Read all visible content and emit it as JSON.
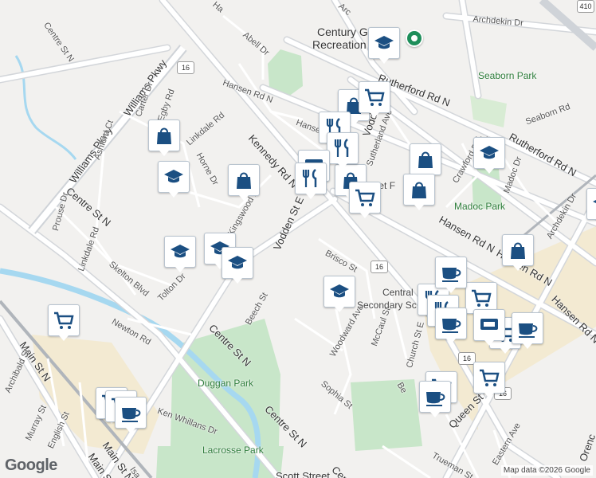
{
  "map": {
    "attribution": "Map data ©2026 Google",
    "logo": "Google",
    "pin_color": "#1e8e5a",
    "marker_icon_color": "#1b4f82",
    "road_labels": [
      {
        "id": "centre-st-n-nw",
        "text": "Centre St N"
      },
      {
        "id": "williams-pkwy-1",
        "text": "Williams Pkwy"
      },
      {
        "id": "williams-pkwy-2",
        "text": "Williams Pkwy"
      },
      {
        "id": "carter-dr",
        "text": "Carter Dr"
      },
      {
        "id": "egby-rd",
        "text": "Egby Rd"
      },
      {
        "id": "ashford-ct",
        "text": "Ashford Ct"
      },
      {
        "id": "linkdale-rd-1",
        "text": "Linkdale Rd"
      },
      {
        "id": "horne-dr",
        "text": "Horne Dr"
      },
      {
        "id": "kingswood-dr",
        "text": "Kingswood Dr"
      },
      {
        "id": "centre-st-n-mid",
        "text": "Centre St N"
      },
      {
        "id": "prouse-dr",
        "text": "Prouse Dr"
      },
      {
        "id": "linkdale-rd-2",
        "text": "Linkdale Rd"
      },
      {
        "id": "skelton-blvd",
        "text": "Skelton Blvd"
      },
      {
        "id": "tolton-dr",
        "text": "Tolton Dr"
      },
      {
        "id": "newton-rd",
        "text": "Newton Rd"
      },
      {
        "id": "abell-dr",
        "text": "Abell Dr"
      },
      {
        "id": "hansen-rd-n-1",
        "text": "Hansen Rd N"
      },
      {
        "id": "hansen-rd-n-2",
        "text": "Hansen Rd N"
      },
      {
        "id": "hansen-rd-n-3",
        "text": "Hansen Rd N"
      },
      {
        "id": "hansen-rd-n-4",
        "text": "Hansen Rd N"
      },
      {
        "id": "hansen-short",
        "text": "Hanse"
      },
      {
        "id": "kennedy-rd-n",
        "text": "Kennedy Rd N"
      },
      {
        "id": "vodden-st-e",
        "text": "Vodden St E"
      },
      {
        "id": "vodd",
        "text": "Vodd"
      },
      {
        "id": "sutherland-ave",
        "text": "Sutherland Ave"
      },
      {
        "id": "rutherford-rd-n-1",
        "text": "Rutherford Rd N"
      },
      {
        "id": "rutherford-rd-n-2",
        "text": "Rutherford Rd N"
      },
      {
        "id": "archdekin-dr-1",
        "text": "Archdekin Dr"
      },
      {
        "id": "archdekin-dr-2",
        "text": "Archdekin Dr"
      },
      {
        "id": "seaborn-rd",
        "text": "Seaborn Rd"
      },
      {
        "id": "crawford-dr",
        "text": "Crawford Dr"
      },
      {
        "id": "madoc-dr",
        "text": "Madoc Dr"
      },
      {
        "id": "m-a",
        "text": "M A"
      },
      {
        "id": "brisco-st",
        "text": "Brisco St"
      },
      {
        "id": "woodward-ave",
        "text": "Woodward Ave"
      },
      {
        "id": "mccaul-st",
        "text": "McCaul St"
      },
      {
        "id": "church-st-e",
        "text": "Church St E"
      },
      {
        "id": "sophia-st",
        "text": "Sophia St"
      },
      {
        "id": "beech-st",
        "text": "Beech St"
      },
      {
        "id": "centre-st-n-low",
        "text": "Centre St N"
      },
      {
        "id": "centre-st-n-bottom",
        "text": "Centre St N"
      },
      {
        "id": "main-st-n-1",
        "text": "Main St N"
      },
      {
        "id": "main-st-n-2",
        "text": "Main St N"
      },
      {
        "id": "archibald-st",
        "text": "Archibald St"
      },
      {
        "id": "murray-st",
        "text": "Murray St"
      },
      {
        "id": "english-st",
        "text": "English St"
      },
      {
        "id": "ken-whillans-dr",
        "text": "Ken Whillans Dr"
      },
      {
        "id": "queen-st",
        "text": "Queen St"
      },
      {
        "id": "be-short",
        "text": "Be"
      },
      {
        "id": "eastern-ave",
        "text": "Eastern Ave"
      },
      {
        "id": "trueman-st",
        "text": "Trueman St"
      },
      {
        "id": "oren",
        "text": "Orenc"
      },
      {
        "id": "centr-bottom",
        "text": "Centr"
      },
      {
        "id": "scott-street",
        "text": "Scott Street"
      },
      {
        "id": "main-st-w",
        "text": "Main St W"
      },
      {
        "id": "isa",
        "text": "Isa"
      },
      {
        "id": "top-arc",
        "text": "Arc"
      },
      {
        "id": "top-ha",
        "text": "Ha"
      }
    ],
    "place_labels": [
      {
        "id": "century-recreation",
        "text": "Century Gardens Recreation Centre",
        "line1": "Century G",
        "line2": "Recreation"
      },
      {
        "id": "seaborn-park",
        "text": "Seaborn Park"
      },
      {
        "id": "madoc-park",
        "text": "Madoc Park"
      },
      {
        "id": "duggan-park",
        "text": "Duggan Park"
      },
      {
        "id": "lacrosse-park",
        "text": "Lacrosse Park"
      },
      {
        "id": "central-secondary",
        "line1": "Central",
        "line2": "Secondary Sc"
      },
      {
        "id": "planet-fragment",
        "text": "anet F"
      }
    ],
    "highway_shields": [
      "16",
      "16",
      "16",
      "16",
      "410"
    ],
    "markers": [
      {
        "id": "school-1",
        "type": "school"
      },
      {
        "id": "school-2",
        "type": "school"
      },
      {
        "id": "school-3",
        "type": "school"
      },
      {
        "id": "school-4",
        "type": "school"
      },
      {
        "id": "school-5",
        "type": "school"
      },
      {
        "id": "school-6",
        "type": "school"
      },
      {
        "id": "school-7",
        "type": "school"
      },
      {
        "id": "school-8",
        "type": "school"
      },
      {
        "id": "shop-1",
        "type": "shopping-bag"
      },
      {
        "id": "shop-2",
        "type": "shopping-bag"
      },
      {
        "id": "shop-3",
        "type": "shopping-bag"
      },
      {
        "id": "shop-4",
        "type": "shopping-bag"
      },
      {
        "id": "shop-5",
        "type": "shopping-bag"
      },
      {
        "id": "shop-6",
        "type": "shopping-bag"
      },
      {
        "id": "shop-7",
        "type": "shopping-bag"
      },
      {
        "id": "cart-1",
        "type": "grocery-cart"
      },
      {
        "id": "cart-2",
        "type": "grocery-cart"
      },
      {
        "id": "cart-3",
        "type": "grocery-cart"
      },
      {
        "id": "cart-4",
        "type": "grocery-cart"
      },
      {
        "id": "cart-5",
        "type": "grocery-cart"
      },
      {
        "id": "cart-6",
        "type": "grocery-cart"
      },
      {
        "id": "cart-7",
        "type": "grocery-cart"
      },
      {
        "id": "cart-8",
        "type": "grocery-cart"
      },
      {
        "id": "cart-9",
        "type": "grocery-cart"
      },
      {
        "id": "food-1",
        "type": "restaurant"
      },
      {
        "id": "food-2",
        "type": "restaurant"
      },
      {
        "id": "food-3",
        "type": "restaurant"
      },
      {
        "id": "food-4",
        "type": "restaurant"
      },
      {
        "id": "food-5",
        "type": "restaurant"
      },
      {
        "id": "food-6",
        "type": "restaurant"
      },
      {
        "id": "cafe-1",
        "type": "cafe"
      },
      {
        "id": "cafe-2",
        "type": "cafe"
      },
      {
        "id": "cafe-3",
        "type": "cafe"
      },
      {
        "id": "cafe-4",
        "type": "cafe"
      },
      {
        "id": "cafe-5",
        "type": "cafe"
      },
      {
        "id": "cafe-6",
        "type": "cafe"
      },
      {
        "id": "atm-1",
        "type": "atm"
      },
      {
        "id": "atm-2",
        "type": "atm"
      }
    ]
  }
}
